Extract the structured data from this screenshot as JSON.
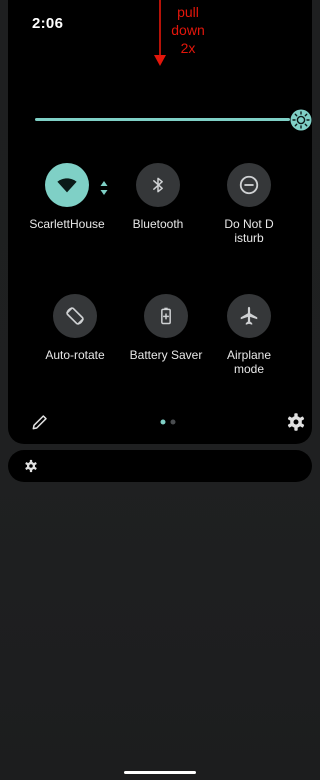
{
  "status_bar": {
    "time": "2:06"
  },
  "annotation": {
    "text": "pull\ndown\n2x",
    "color": "#e3160b"
  },
  "brightness": {
    "level": 0.95,
    "accent": "#7fd0c6",
    "icon": "brightness-sun-icon"
  },
  "tiles": [
    {
      "label": "ScarlettHouse",
      "icon": "wifi-icon",
      "active": true
    },
    {
      "label": "Bluetooth",
      "icon": "bluetooth-icon",
      "active": false
    },
    {
      "label": "Do Not Disturb",
      "icon": "do-not-disturb-icon",
      "active": false
    },
    {
      "label": "Auto-rotate",
      "icon": "auto-rotate-icon",
      "active": false
    },
    {
      "label": "Battery Saver",
      "icon": "battery-saver-icon",
      "active": false
    },
    {
      "label": "Airplane mode",
      "icon": "airplane-icon",
      "active": false
    }
  ],
  "footer": {
    "edit_icon": "pencil-icon",
    "settings_icon": "gear-icon",
    "pages": 2,
    "current_page": 1
  },
  "notification_bar": {
    "icon": "gear-icon"
  },
  "colors": {
    "active_tile": "#7fd0c6",
    "inactive_tile": "#353739",
    "panel": "#000000",
    "background": "#1f2021"
  }
}
